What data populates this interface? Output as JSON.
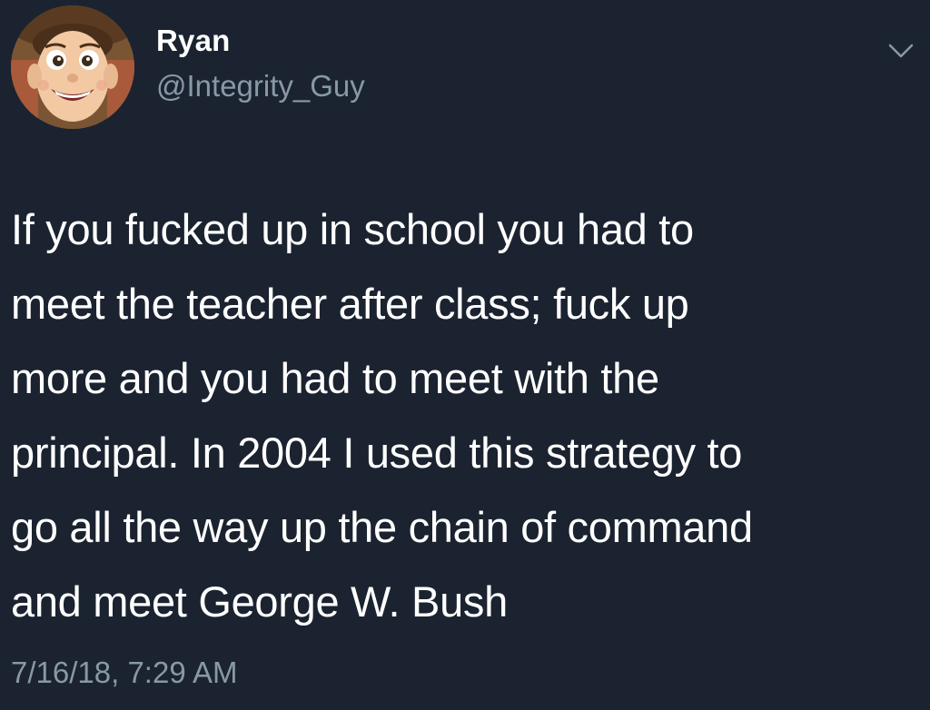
{
  "user": {
    "display_name": "Ryan",
    "handle": "@Integrity_Guy",
    "avatar": "cartoon-cowboy-avatar"
  },
  "tweet": {
    "text": "If you fucked up in school you had to\nmeet the teacher after class; fuck up\nmore and you had to meet with the\nprincipal. In 2004 I used this strategy to\ngo all the way up the chain of command\nand meet George W. Bush",
    "timestamp": "7/16/18, 7:29 AM"
  },
  "icons": {
    "menu": "chevron-down-icon"
  },
  "colors": {
    "background": "#1b2330",
    "primary_text": "#ffffff",
    "secondary_text": "#8899a6"
  }
}
